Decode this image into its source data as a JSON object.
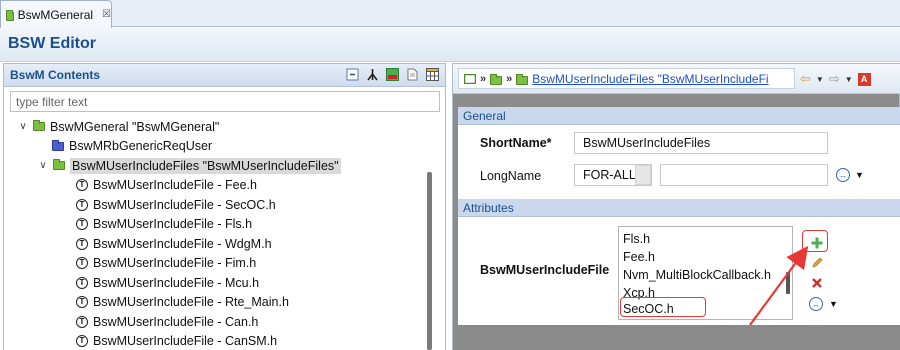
{
  "editor_tab": {
    "label": "BswMGeneral",
    "close_symbol": "☒"
  },
  "header": {
    "title": "BSW Editor"
  },
  "left_panel": {
    "title": "BswM Contents",
    "filter_placeholder": "type filter text",
    "tree": [
      {
        "label": "BswMGeneral \"BswMGeneral\"",
        "icon": "folder-icon",
        "twisty": "∨",
        "depth": 1,
        "selected": false
      },
      {
        "label": "BswMRbGenericReqUser",
        "icon": "blue-folder-icon",
        "twisty": "",
        "depth": 2,
        "selected": false
      },
      {
        "label": "BswMUserIncludeFiles \"BswMUserIncludeFiles\"",
        "icon": "folder-icon",
        "twisty": "∨",
        "depth": 2,
        "selected": true
      },
      {
        "label": "BswMUserIncludeFile - Fee.h",
        "icon": "t-icon",
        "twisty": "",
        "depth": 3,
        "selected": false
      },
      {
        "label": "BswMUserIncludeFile - SecOC.h",
        "icon": "t-icon",
        "twisty": "",
        "depth": 3,
        "selected": false
      },
      {
        "label": "BswMUserIncludeFile - Fls.h",
        "icon": "t-icon",
        "twisty": "",
        "depth": 3,
        "selected": false
      },
      {
        "label": "BswMUserIncludeFile - WdgM.h",
        "icon": "t-icon",
        "twisty": "",
        "depth": 3,
        "selected": false
      },
      {
        "label": "BswMUserIncludeFile - Fim.h",
        "icon": "t-icon",
        "twisty": "",
        "depth": 3,
        "selected": false
      },
      {
        "label": "BswMUserIncludeFile - Mcu.h",
        "icon": "t-icon",
        "twisty": "",
        "depth": 3,
        "selected": false
      },
      {
        "label": "BswMUserIncludeFile - Rte_Main.h",
        "icon": "t-icon",
        "twisty": "",
        "depth": 3,
        "selected": false
      },
      {
        "label": "BswMUserIncludeFile - Can.h",
        "icon": "t-icon",
        "twisty": "",
        "depth": 3,
        "selected": false
      },
      {
        "label": "BswMUserIncludeFile - CanSM.h",
        "icon": "t-icon",
        "twisty": "",
        "depth": 3,
        "selected": false
      }
    ],
    "t_icon_glyph": "T"
  },
  "right_panel": {
    "breadcrumb_link": "BswMUserIncludeFiles \"BswMUserIncludeFi",
    "breadcrumb_sep": "»",
    "nav": {
      "back": "⇦",
      "forward": "⇨",
      "dropdown": "▼",
      "a_badge": "A"
    },
    "general": {
      "header": "General",
      "shortname_label": "ShortName*",
      "shortname_value": "BswMUserIncludeFiles",
      "longname_label": "LongName",
      "longname_lang": "FOR-ALL",
      "longname_value": ""
    },
    "attributes": {
      "header": "Attributes",
      "field_label": "BswMUserIncludeFile",
      "list_items": [
        "Fls.h",
        "Fee.h",
        "Nvm_MultiBlockCallback.h",
        "Xcp.h",
        "SecOC.h"
      ]
    }
  },
  "colors": {
    "title_blue": "#1b4f8c",
    "highlight_red": "#e53935",
    "link_blue": "#1a4ecb"
  }
}
